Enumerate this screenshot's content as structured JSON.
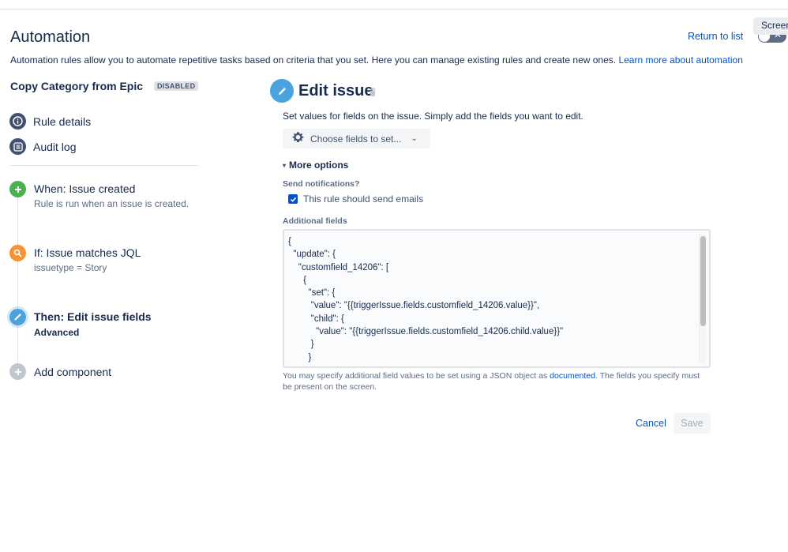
{
  "header": {
    "title": "Automation",
    "return_link": "Return to list",
    "description": "Automation rules allow you to automate repetitive tasks based on criteria that you set. Here you can manage existing rules and create new ones. ",
    "learn_more": "Learn more about automation",
    "screen_tooltip": "Screen",
    "toggle_state": "off"
  },
  "sidebar": {
    "rule_name": "Copy Category from Epic",
    "status_badge": "DISABLED",
    "nav": [
      {
        "label": "Rule details",
        "icon": "info-icon"
      },
      {
        "label": "Audit log",
        "icon": "list-icon"
      }
    ],
    "steps": [
      {
        "title": "When: Issue created",
        "subtitle": "Rule is run when an issue is created.",
        "icon": "plus-icon",
        "color": "#4caf50"
      },
      {
        "title": "If: Issue matches JQL",
        "subtitle": "issuetype = Story",
        "icon": "search-icon",
        "color": "#f79232"
      },
      {
        "title": "Then: Edit issue fields",
        "subtitle": "Advanced",
        "icon": "pencil-icon",
        "color": "#4aa3df"
      },
      {
        "title": "Add component",
        "icon": "plus-icon",
        "color": "#c1c7d0"
      }
    ]
  },
  "panel": {
    "title": "Edit issue",
    "description": "Set values for fields on the issue. Simply add the fields you want to edit.",
    "choose_fields": "Choose fields to set...",
    "more_options": "More options",
    "send_notifications_label": "Send notifications?",
    "send_emails_checkbox": {
      "label": "This rule should send emails",
      "checked": true
    },
    "additional_fields_label": "Additional fields",
    "additional_fields_value": "{\n  \"update\": {\n    \"customfield_14206\": [\n      {\n        \"set\": {\n         \"value\": \"{{triggerIssue.fields.customfield_14206.value}}\",\n         \"child\": {\n           \"value\": \"{{triggerIssue.fields.customfield_14206.child.value}}\"\n         }\n        }",
    "help_text_before": "You may specify additional field values to be set using a JSON object as ",
    "help_link": "documented",
    "help_text_after": ". The fields you specify must be present on the screen.",
    "cancel_label": "Cancel",
    "save_label": "Save"
  },
  "colors": {
    "link": "#0052cc",
    "text": "#172b4d",
    "muted": "#5e6c84"
  }
}
